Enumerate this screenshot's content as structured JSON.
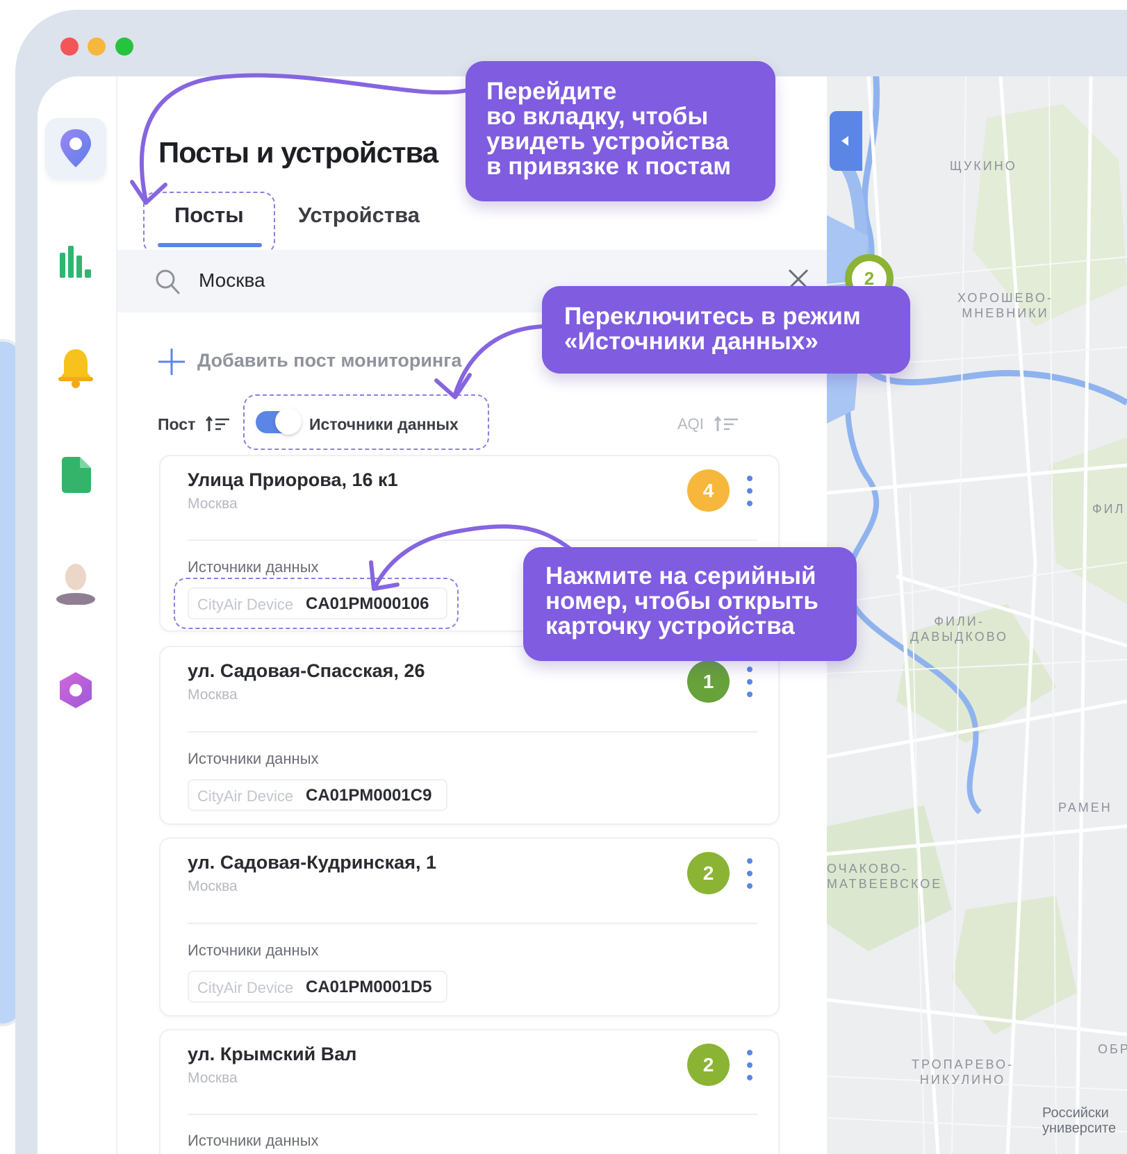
{
  "window": {
    "controls": [
      "close",
      "minimize",
      "maximize"
    ]
  },
  "sidebar": {
    "items": [
      {
        "icon": "map-pin-icon",
        "active": true
      },
      {
        "icon": "bar-chart-icon",
        "active": false
      },
      {
        "icon": "bell-icon",
        "active": false
      },
      {
        "icon": "document-icon",
        "active": false
      },
      {
        "icon": "user-avatar-icon",
        "active": false
      },
      {
        "icon": "hexagon-icon",
        "active": false
      }
    ]
  },
  "panel": {
    "title": "Посты и устройства",
    "tabs": [
      {
        "label": "Посты",
        "active": true
      },
      {
        "label": "Устройства",
        "active": false
      }
    ],
    "search": {
      "value": "Москва"
    },
    "add_post_label": "Добавить пост мониторинга",
    "sort": {
      "post_label": "Пост",
      "toggle_label": "Источники данных",
      "toggle_on": true,
      "aqi_label": "AQI"
    },
    "posts": [
      {
        "name": "Улица Приорова, 16 к1",
        "city": "Москва",
        "aqi": "4",
        "aqi_color": "#f6b73c",
        "sources_label": "Источники данных",
        "device_type": "CityAir Device",
        "serial": "CA01PM000106"
      },
      {
        "name": "ул. Садовая-Спасская, 26",
        "city": "Москва",
        "aqi": "1",
        "aqi_color": "#67a23a",
        "sources_label": "Источники данных",
        "device_type": "CityAir Device",
        "serial": "CA01PM0001C9"
      },
      {
        "name": "ул. Садовая-Кудринская, 1",
        "city": "Москва",
        "aqi": "2",
        "aqi_color": "#8bb334",
        "sources_label": "Источники данных",
        "device_type": "CityAir Device",
        "serial": "CA01PM0001D5"
      },
      {
        "name": "ул. Крымский Вал",
        "city": "Москва",
        "aqi": "2",
        "aqi_color": "#8bb334",
        "sources_label": "Источники данных"
      }
    ]
  },
  "map": {
    "cluster_count": "2",
    "labels": [
      "ЩУКИНО",
      "ХОРОШЕВО-\nМНЕВНИКИ",
      "ФИЛ",
      "ФИЛИ-\nДАВЫДКОВО",
      "РАМЕН",
      "ОЧАКОВО-\nМАТВЕЕВСКОЕ",
      "ТРОПАРЕВО-\nНИКУЛИНО",
      "ОБР",
      "Российски\nуниверсите"
    ]
  },
  "callouts": [
    {
      "text": "Перейдите\nво вкладку, чтобы\nувидеть устройства\nв привязке к постам"
    },
    {
      "text": "Переключитесь в режим\n«Источники данных»"
    },
    {
      "text": "Нажмите на серийный\nномер, чтобы открыть\nкарточку устройства"
    }
  ],
  "colors": {
    "accent": "#5b86e5",
    "callout": "#7f5ce0",
    "window": "#dde3ec"
  }
}
